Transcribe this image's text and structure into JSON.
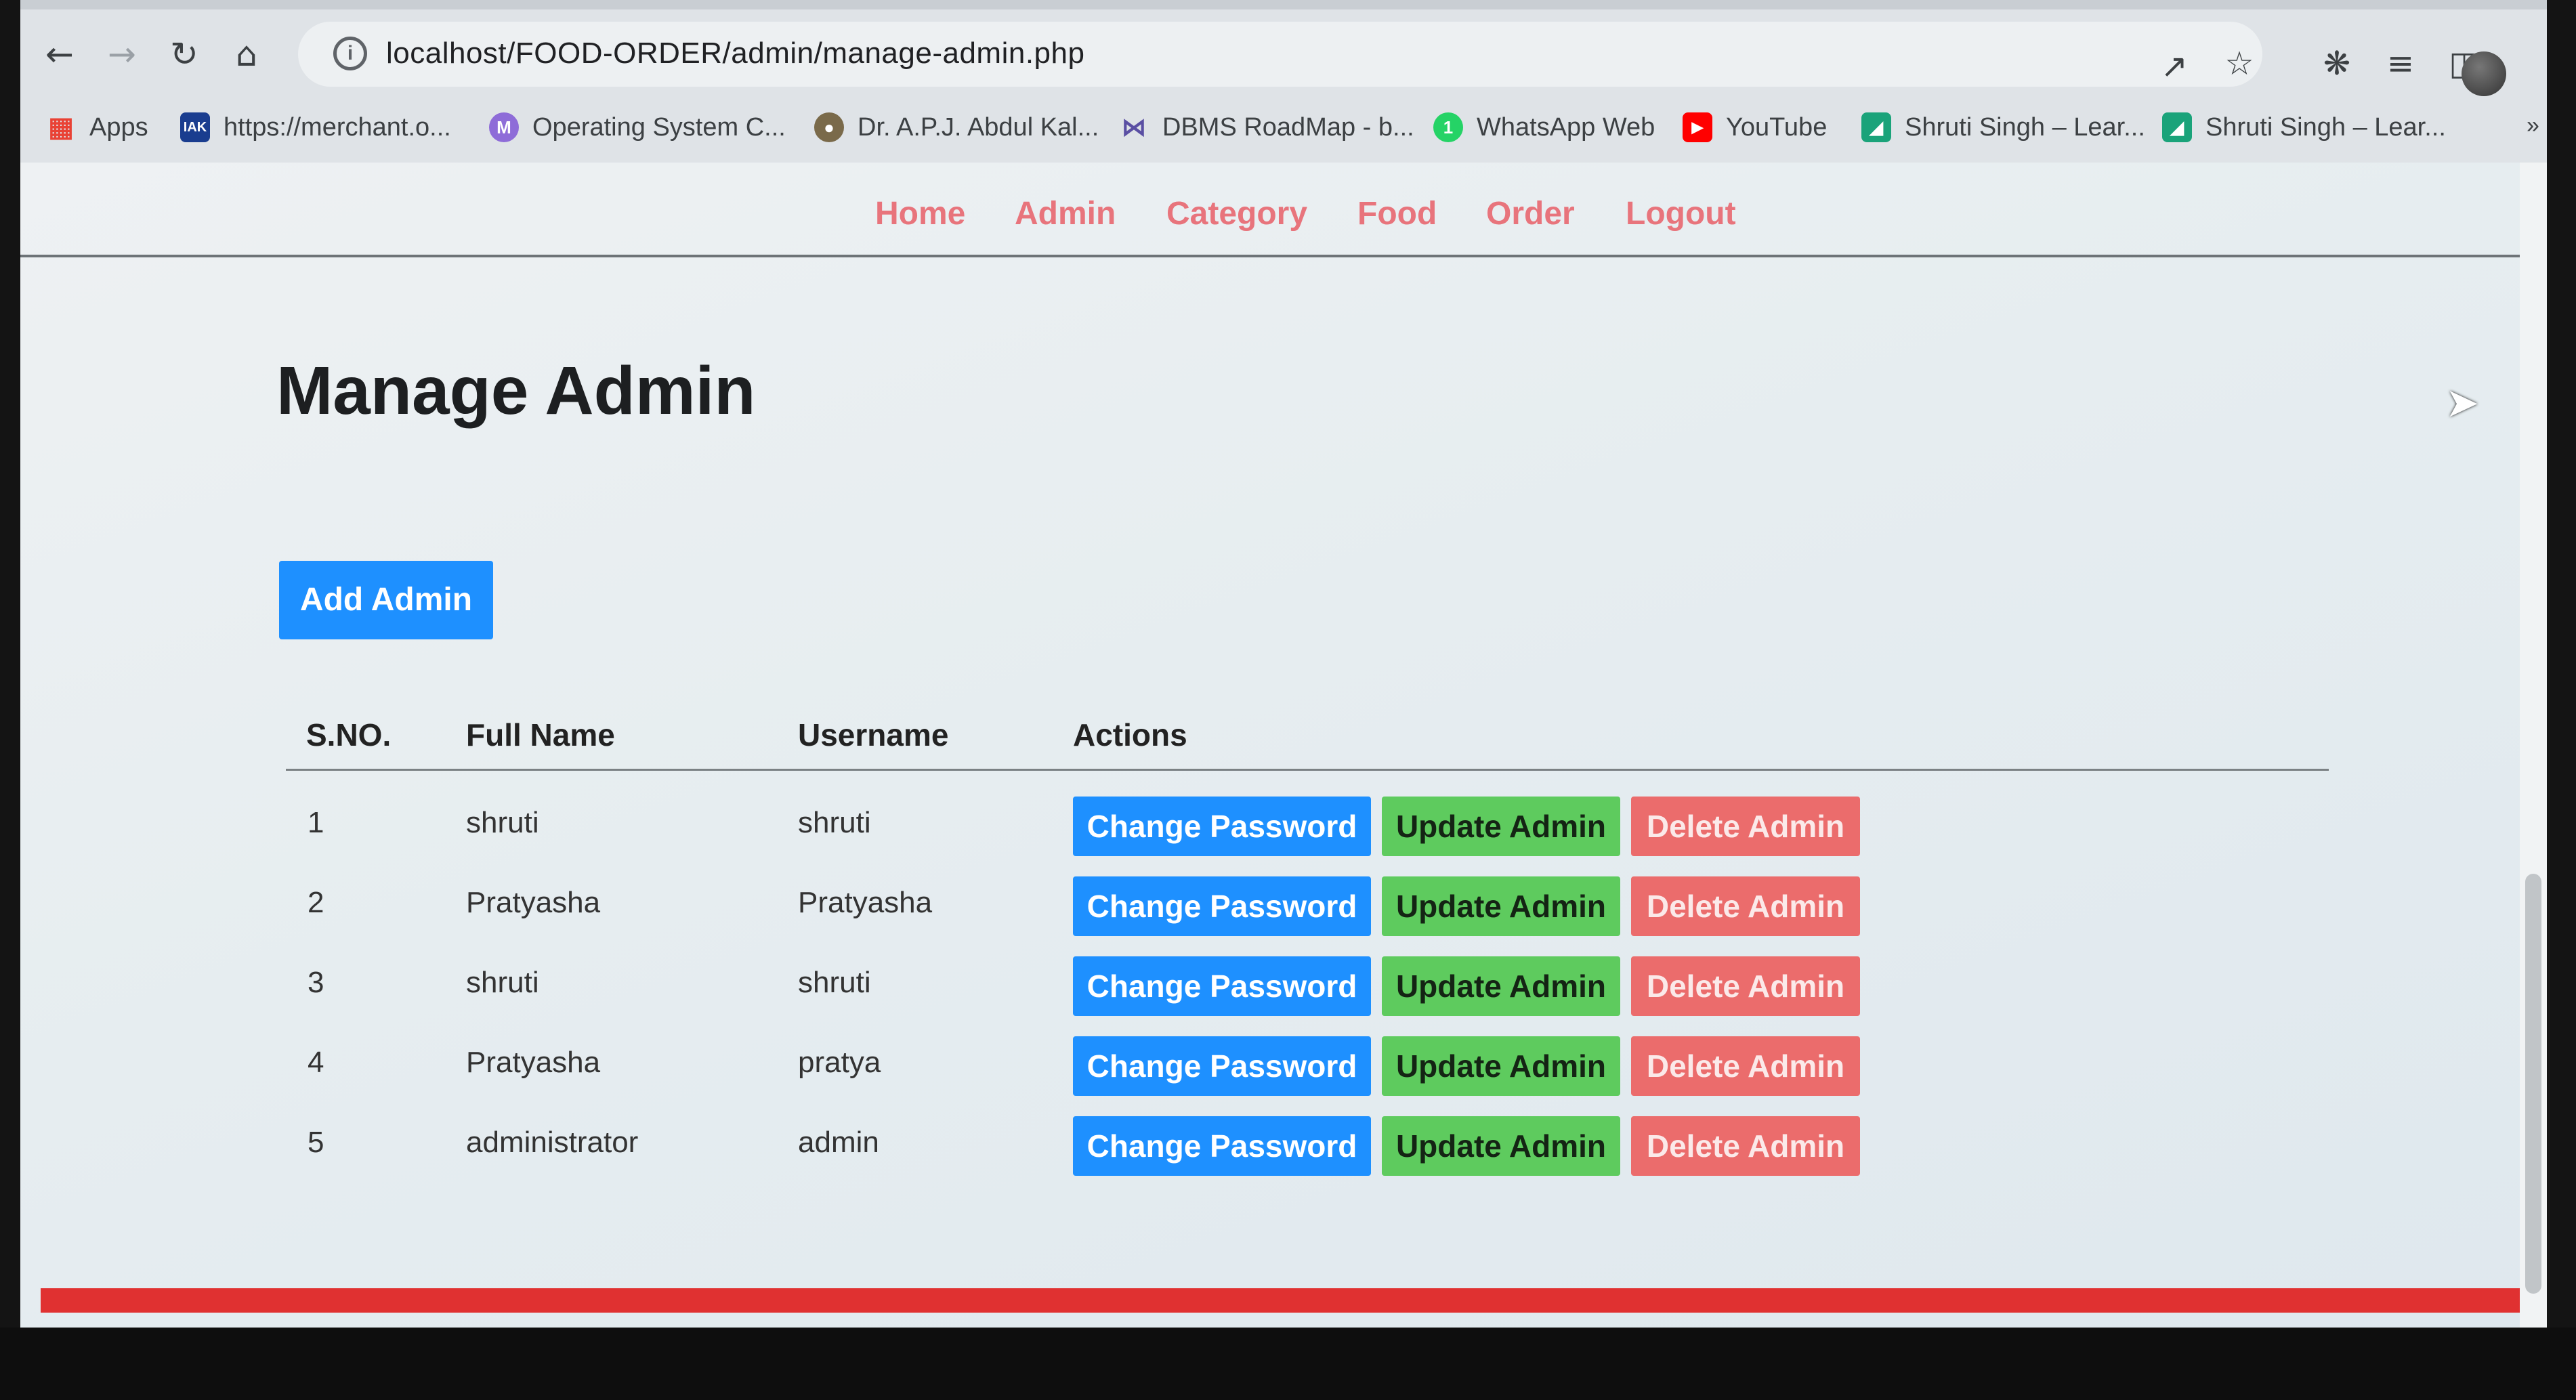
{
  "browser": {
    "url": "localhost/FOOD-ORDER/admin/manage-admin.php",
    "bookmarks": [
      {
        "label": "Apps",
        "icon": "apps-grid-icon",
        "color": "#e94235"
      },
      {
        "label": "https://merchant.o...",
        "icon": "merchant-icon",
        "color": "#1a3d8f"
      },
      {
        "label": "Operating System C...",
        "icon": "m-letter-icon",
        "color": "#8e6cd8"
      },
      {
        "label": "Dr. A.P.J. Abdul Kal...",
        "icon": "globe-icon",
        "color": "#7a6a4a"
      },
      {
        "label": "DBMS RoadMap - b...",
        "icon": "roadmap-icon",
        "color": "#5a4fa3"
      },
      {
        "label": "WhatsApp Web",
        "icon": "whatsapp-icon",
        "color": "#25d366"
      },
      {
        "label": "YouTube",
        "icon": "youtube-icon",
        "color": "#ff0000"
      },
      {
        "label": "Shruti Singh – Lear...",
        "icon": "learn-icon",
        "color": "#1aa37a"
      },
      {
        "label": "Shruti Singh – Lear...",
        "icon": "learn-icon",
        "color": "#1aa37a"
      }
    ]
  },
  "menu": [
    "Home",
    "Admin",
    "Category",
    "Food",
    "Order",
    "Logout"
  ],
  "page": {
    "title": "Manage Admin",
    "add_button": "Add Admin"
  },
  "table": {
    "headers": [
      "S.NO.",
      "Full Name",
      "Username",
      "Actions"
    ],
    "rows": [
      {
        "sno": "1",
        "full_name": "shruti",
        "username": "shruti"
      },
      {
        "sno": "2",
        "full_name": "Pratyasha",
        "username": "Pratyasha"
      },
      {
        "sno": "3",
        "full_name": "shruti",
        "username": "shruti"
      },
      {
        "sno": "4",
        "full_name": "Pratyasha",
        "username": "pratya"
      },
      {
        "sno": "5",
        "full_name": "administrator",
        "username": "admin"
      }
    ],
    "actions": {
      "change_password": "Change Password",
      "update": "Update Admin",
      "delete": "Delete Admin"
    }
  },
  "colors": {
    "accent_blue": "#1e90ff",
    "update_green": "#5ecb5e",
    "delete_red": "#eb6c6c",
    "menu_link": "#e8747c",
    "footer_red": "#e03131"
  }
}
